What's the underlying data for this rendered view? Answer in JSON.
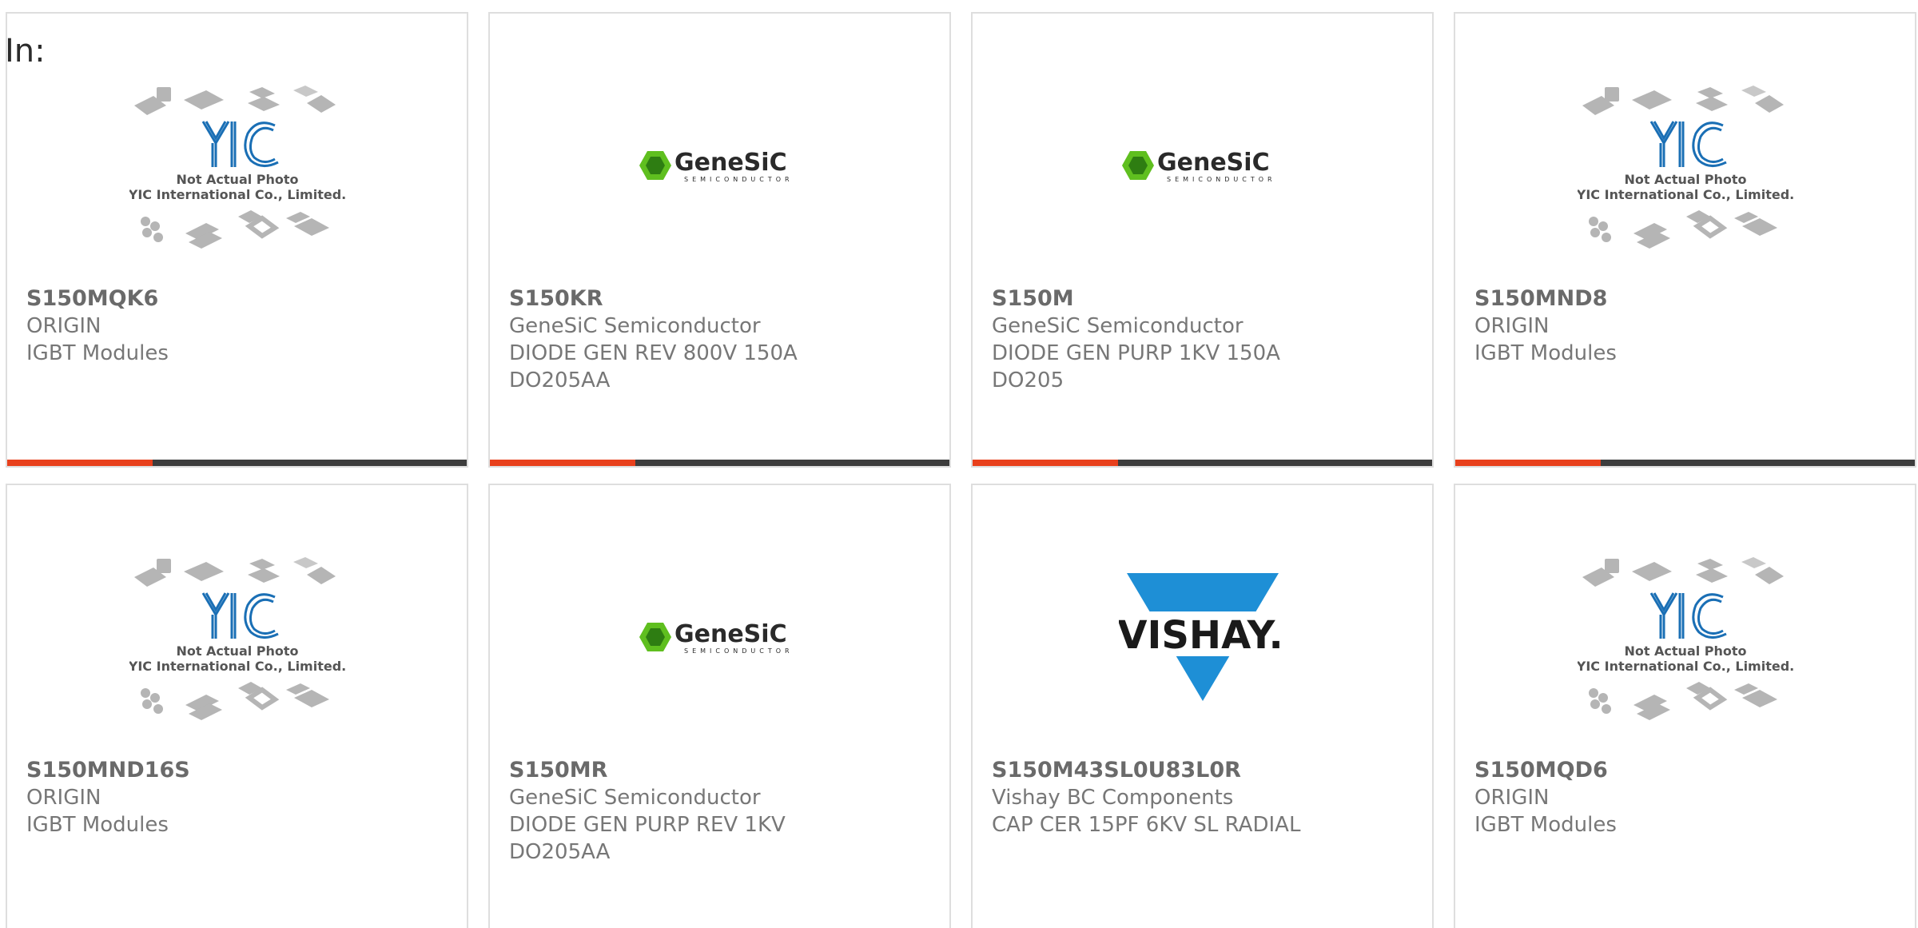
{
  "header": {
    "in_label": "In:"
  },
  "products": [
    {
      "part_number": "S150MQK6",
      "manufacturer": "ORIGIN",
      "description": "IGBT Modules",
      "package": "",
      "image": "yic-placeholder"
    },
    {
      "part_number": "S150KR",
      "manufacturer": "GeneSiC Semiconductor",
      "description": "DIODE GEN REV 800V 150A",
      "package": "DO205AA",
      "image": "genesic-logo"
    },
    {
      "part_number": "S150M",
      "manufacturer": "GeneSiC Semiconductor",
      "description": "DIODE GEN PURP 1KV 150A",
      "package": "DO205",
      "image": "genesic-logo"
    },
    {
      "part_number": "S150MND8",
      "manufacturer": "ORIGIN",
      "description": "IGBT Modules",
      "package": "",
      "image": "yic-placeholder"
    },
    {
      "part_number": "S150MND16S",
      "manufacturer": "ORIGIN",
      "description": "IGBT Modules",
      "package": "",
      "image": "yic-placeholder"
    },
    {
      "part_number": "S150MR",
      "manufacturer": "GeneSiC Semiconductor",
      "description": "DIODE GEN PURP REV 1KV",
      "package": "DO205AA",
      "image": "genesic-logo"
    },
    {
      "part_number": "S150M43SL0U83L0R",
      "manufacturer": "Vishay BC Components",
      "description": "CAP CER 15PF 6KV SL RADIAL",
      "package": "",
      "image": "vishay-logo"
    },
    {
      "part_number": "S150MQD6",
      "manufacturer": "ORIGIN",
      "description": "IGBT Modules",
      "package": "",
      "image": "yic-placeholder"
    }
  ],
  "placeholder_image": {
    "caption_line1": "Not Actual Photo",
    "caption_line2": "YIC International Co., Limited.",
    "logo_text": "YIC"
  },
  "logos": {
    "genesic_name": "GeneSiC",
    "genesic_sub": "SEMICONDUCTOR",
    "vishay_name": "VISHAY."
  },
  "colors": {
    "accent": "#e8401c",
    "bar": "#3d3d3d",
    "genesic_green": "#5fbf1f",
    "vishay_blue": "#1e8fd6",
    "yic_blue": "#1a6fb5"
  }
}
